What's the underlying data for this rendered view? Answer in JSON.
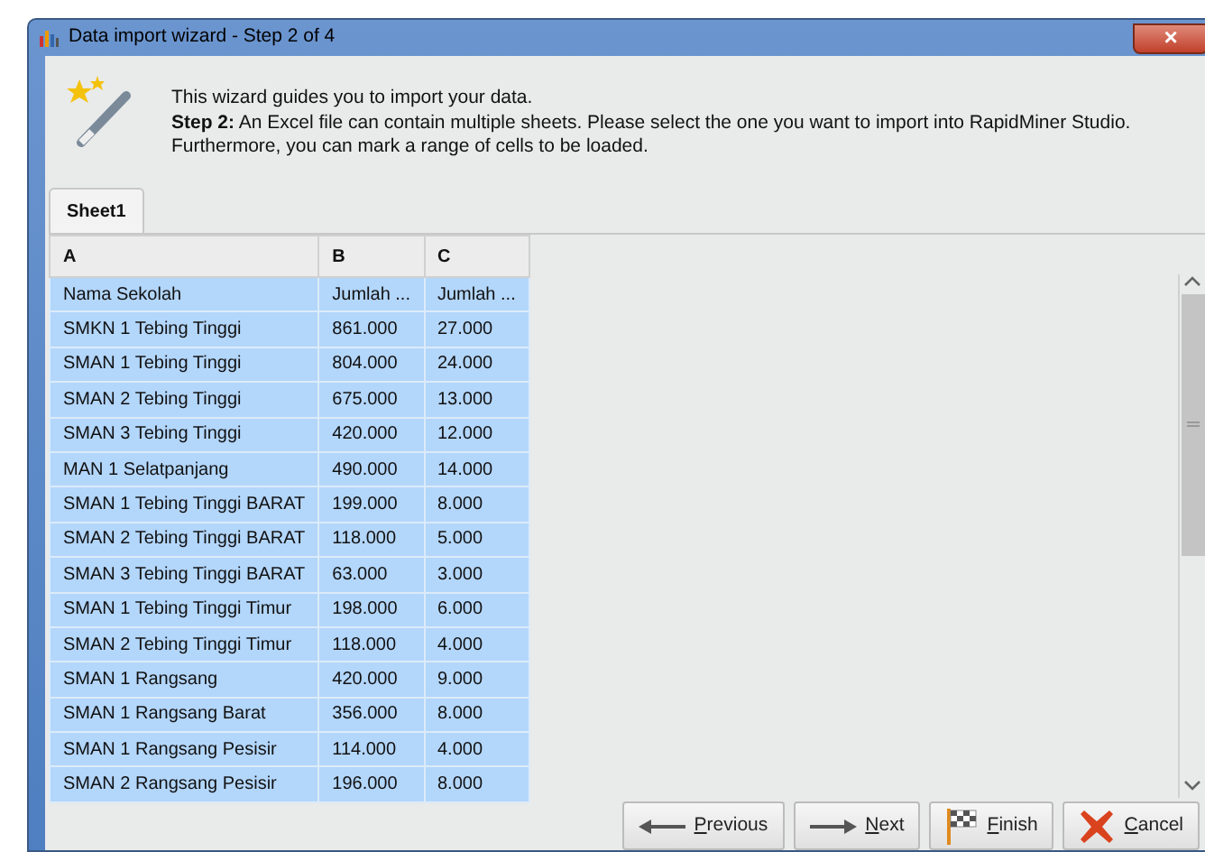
{
  "window": {
    "title": "Data import wizard - Step 2 of 4",
    "close": "×"
  },
  "intro": [
    "This wizard guides you to import your data.",
    "**Step 2:** An Excel file can contain multiple sheets. Please select the one you want to import into RapidMiner Studio.",
    "Furthermore, you can mark a range of cells to be loaded."
  ],
  "tabs": [
    {
      "label": "Sheet1",
      "selected": true
    }
  ],
  "table": {
    "columns": [
      "A",
      "B",
      "C"
    ],
    "rows": [
      [
        "Nama Sekolah",
        "Jumlah ...",
        "Jumlah ..."
      ],
      [
        "SMKN 1 Tebing Tinggi",
        "861.000",
        "27.000"
      ],
      [
        "SMAN 1 Tebing Tinggi",
        "804.000",
        "24.000"
      ],
      [
        "SMAN 2 Tebing Tinggi",
        "675.000",
        "13.000"
      ],
      [
        "SMAN 3 Tebing Tinggi",
        "420.000",
        "12.000"
      ],
      [
        "MAN 1 Selatpanjang",
        "490.000",
        "14.000"
      ],
      [
        "SMAN 1 Tebing Tinggi BARAT",
        "199.000",
        "8.000"
      ],
      [
        "SMAN 2 Tebing Tinggi BARAT",
        "118.000",
        "5.000"
      ],
      [
        "SMAN 3 Tebing Tinggi BARAT",
        "63.000",
        "3.000"
      ],
      [
        "SMAN 1 Tebing Tinggi Timur",
        "198.000",
        "6.000"
      ],
      [
        "SMAN 2 Tebing Tinggi Timur",
        "118.000",
        "4.000"
      ],
      [
        "SMAN 1 Rangsang",
        "420.000",
        "9.000"
      ],
      [
        "SMAN 1 Rangsang Barat",
        "356.000",
        "8.000"
      ],
      [
        "SMAN 1 Rangsang Pesisir",
        "114.000",
        "4.000"
      ],
      [
        "SMAN 2 Rangsang Pesisir",
        "196.000",
        "8.000"
      ]
    ],
    "selected": true
  },
  "buttons": [
    {
      "label": "Previous",
      "kind": "previous"
    },
    {
      "label": "Next",
      "kind": "next"
    },
    {
      "label": "Finish",
      "kind": "finish"
    },
    {
      "label": "Cancel",
      "kind": "cancel"
    }
  ]
}
